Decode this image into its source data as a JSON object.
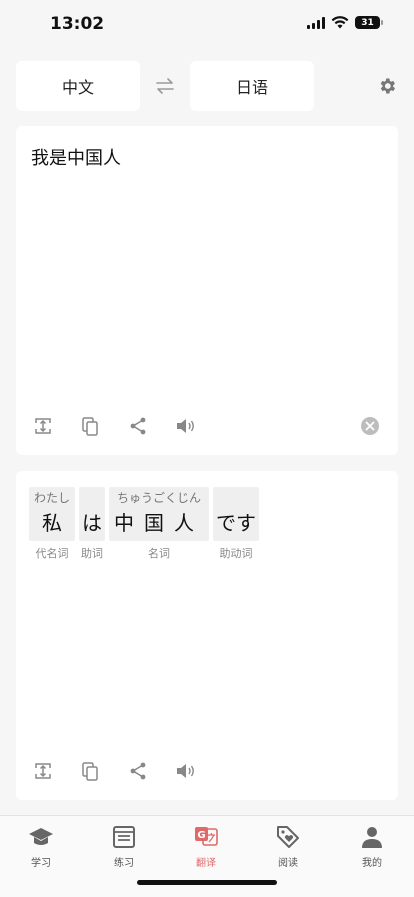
{
  "status": {
    "time": "13:02",
    "battery": "31"
  },
  "languages": {
    "source": "中文",
    "target": "日语"
  },
  "source": {
    "text": "我是中国人"
  },
  "tokens": [
    {
      "reading": "わたし",
      "word": "私",
      "pos": "代名词"
    },
    {
      "reading": "",
      "word": "は",
      "pos": "助词"
    },
    {
      "reading": "ちゅうごくじん",
      "word": "中国人",
      "pos": "名词"
    },
    {
      "reading": "",
      "word": "です",
      "pos": "助动词"
    }
  ],
  "nav": [
    {
      "label": "学习",
      "icon": "graduation-cap-icon"
    },
    {
      "label": "练习",
      "icon": "notebook-icon"
    },
    {
      "label": "翻译",
      "icon": "translate-icon",
      "active": true
    },
    {
      "label": "阅读",
      "icon": "tag-heart-icon"
    },
    {
      "label": "我的",
      "icon": "person-icon"
    }
  ],
  "colors": {
    "accent": "#e06a6a",
    "background": "#f6f6f6",
    "card": "#ffffff"
  }
}
